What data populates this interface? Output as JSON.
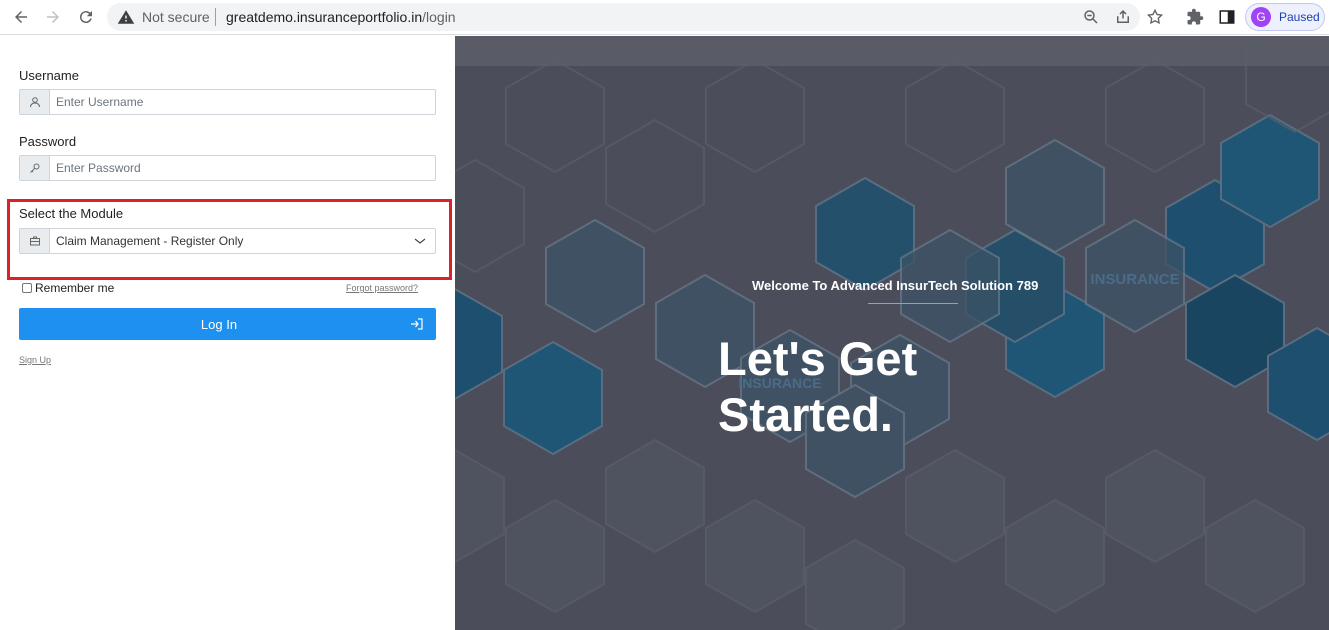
{
  "browser": {
    "security_label": "Not secure",
    "url_host": "greatdemo.insuranceportfolio.in",
    "url_path": "/login",
    "profile_initial": "G",
    "profile_status": "Paused"
  },
  "login": {
    "username_label": "Username",
    "username_placeholder": "Enter Username",
    "password_label": "Password",
    "password_placeholder": "Enter Password",
    "module_label": "Select the Module",
    "module_selected": "Claim Management - Register Only",
    "remember_label": "Remember me",
    "forgot_link": "Forgot password?",
    "login_button": "Log In",
    "signup_link": "Sign Up"
  },
  "hero": {
    "welcome_text": "Welcome To Advanced InsurTech Solution 789",
    "headline": "Let's Get Started.",
    "hex_text": "INSURANCE"
  },
  "colors": {
    "accent": "#1e90ef",
    "highlight": "#d9222a",
    "hero_bg": "#4b4e5a",
    "hex_blue": "#1e4f6e"
  }
}
